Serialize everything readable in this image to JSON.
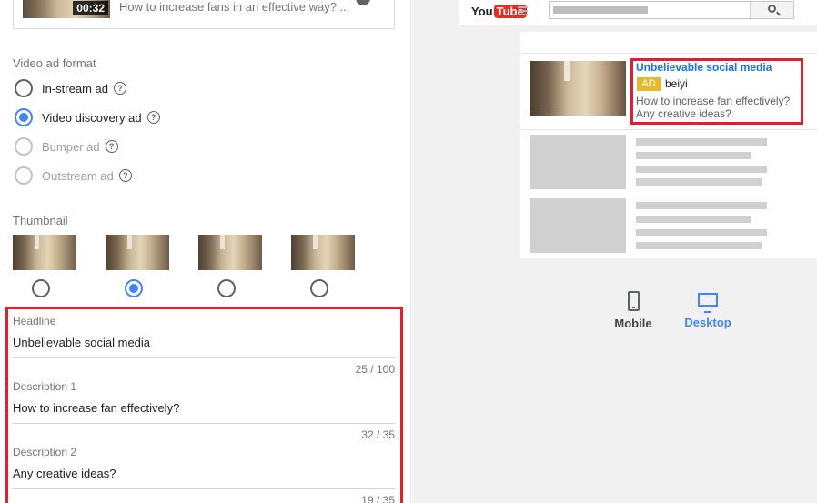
{
  "video_card": {
    "duration": "00:32",
    "description": "How to increase fans in an effective way? ..."
  },
  "ad_format": {
    "label": "Video ad format",
    "options": [
      {
        "label": "In-stream ad",
        "selected": false,
        "disabled": false
      },
      {
        "label": "Video discovery ad",
        "selected": true,
        "disabled": false
      },
      {
        "label": "Bumper ad",
        "selected": false,
        "disabled": true
      },
      {
        "label": "Outstream ad",
        "selected": false,
        "disabled": true
      }
    ],
    "help_glyph": "?"
  },
  "thumbnail": {
    "label": "Thumbnail",
    "selected_index": 1,
    "count": 4
  },
  "fields": {
    "headline": {
      "label": "Headline",
      "value": "Unbelievable social media",
      "count": "25 / 100"
    },
    "description1": {
      "label": "Description 1",
      "value": "How to increase fan effectively?",
      "count": "32 / 35"
    },
    "description2": {
      "label": "Description 2",
      "value": "Any creative ideas?",
      "count": "19 / 35"
    }
  },
  "preview": {
    "logo_you": "You",
    "logo_tube": "Tube",
    "ad_title": "Unbelievable social media",
    "ad_badge": "AD",
    "channel": "beiyi",
    "desc1": "How to increase fan effectively?",
    "desc2": "Any creative ideas?"
  },
  "devices": {
    "mobile": "Mobile",
    "desktop": "Desktop"
  },
  "colors": {
    "accent": "#4285f4",
    "highlight": "#e0202d",
    "ad_badge": "#e6b82e",
    "ad_title": "#1a73e8"
  }
}
